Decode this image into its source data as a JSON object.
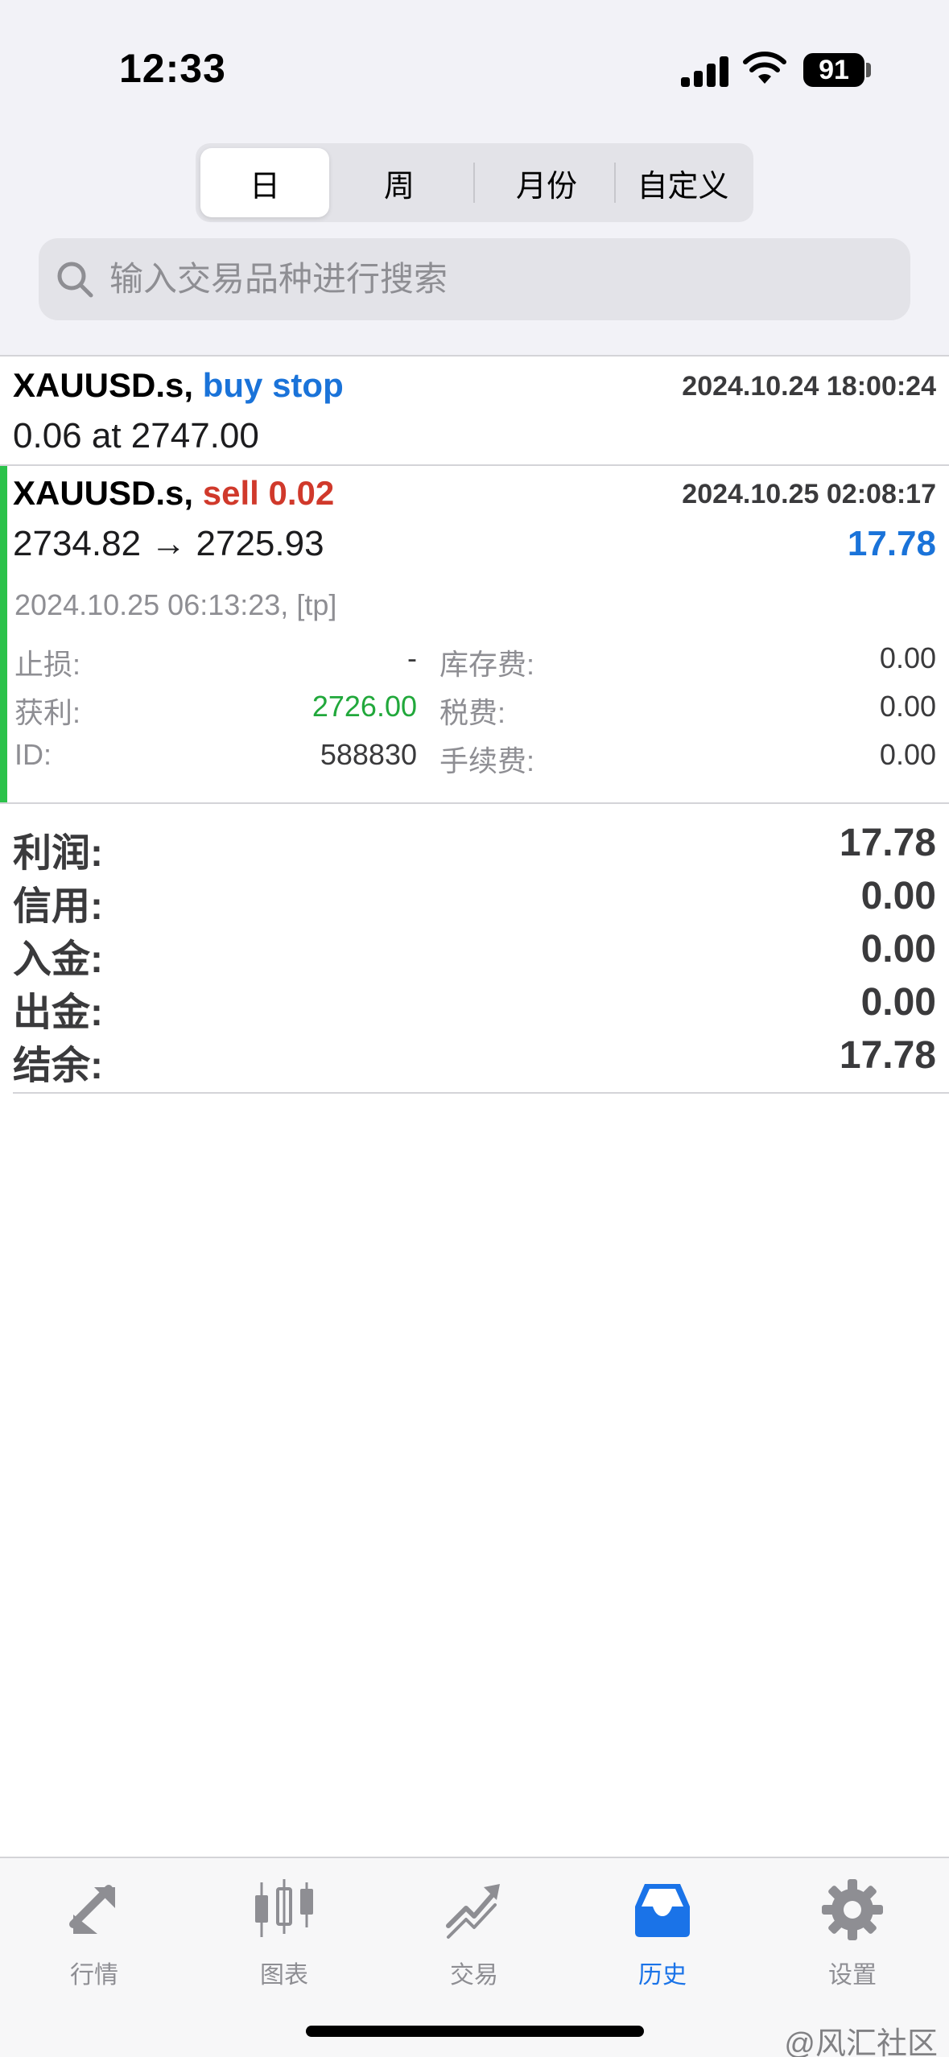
{
  "status": {
    "time": "12:33",
    "battery": "91"
  },
  "tabs_period": [
    "日",
    "周",
    "月份",
    "自定义"
  ],
  "search": {
    "placeholder": "输入交易品种进行搜索"
  },
  "orders": [
    {
      "symbol": "XAUUSD.s,",
      "action": "buy stop",
      "datetime": "2024.10.24 18:00:24",
      "detail": "0.06 at 2747.00"
    },
    {
      "symbol": "XAUUSD.s,",
      "action": "sell 0.02",
      "datetime": "2024.10.25 02:08:17",
      "detail": "2734.82 → 2725.93",
      "profit": "17.78",
      "close_info": "2024.10.25 06:13:23, [tp]",
      "fields": {
        "sl_label": "止损:",
        "sl_value": "-",
        "tp_label": "获利:",
        "tp_value": "2726.00",
        "id_label": "ID:",
        "id_value": "588830",
        "swap_label": "库存费:",
        "swap_value": "0.00",
        "tax_label": "税费:",
        "tax_value": "0.00",
        "fee_label": "手续费:",
        "fee_value": "0.00"
      }
    }
  ],
  "summary": [
    {
      "label": "利润:",
      "value": "17.78"
    },
    {
      "label": "信用:",
      "value": "0.00"
    },
    {
      "label": "入金:",
      "value": "0.00"
    },
    {
      "label": "出金:",
      "value": "0.00"
    },
    {
      "label": "结余:",
      "value": "17.78"
    }
  ],
  "tabbar": [
    {
      "label": "行情",
      "icon": "quotes-icon"
    },
    {
      "label": "图表",
      "icon": "chart-icon"
    },
    {
      "label": "交易",
      "icon": "trade-icon"
    },
    {
      "label": "历史",
      "icon": "history-icon"
    },
    {
      "label": "设置",
      "icon": "gear-icon"
    }
  ],
  "watermark": "@风汇社区",
  "colors": {
    "blue": "#1a73d9",
    "red": "#d0392b",
    "green": "#2bc24a",
    "active_tab": "#1a73e8"
  }
}
